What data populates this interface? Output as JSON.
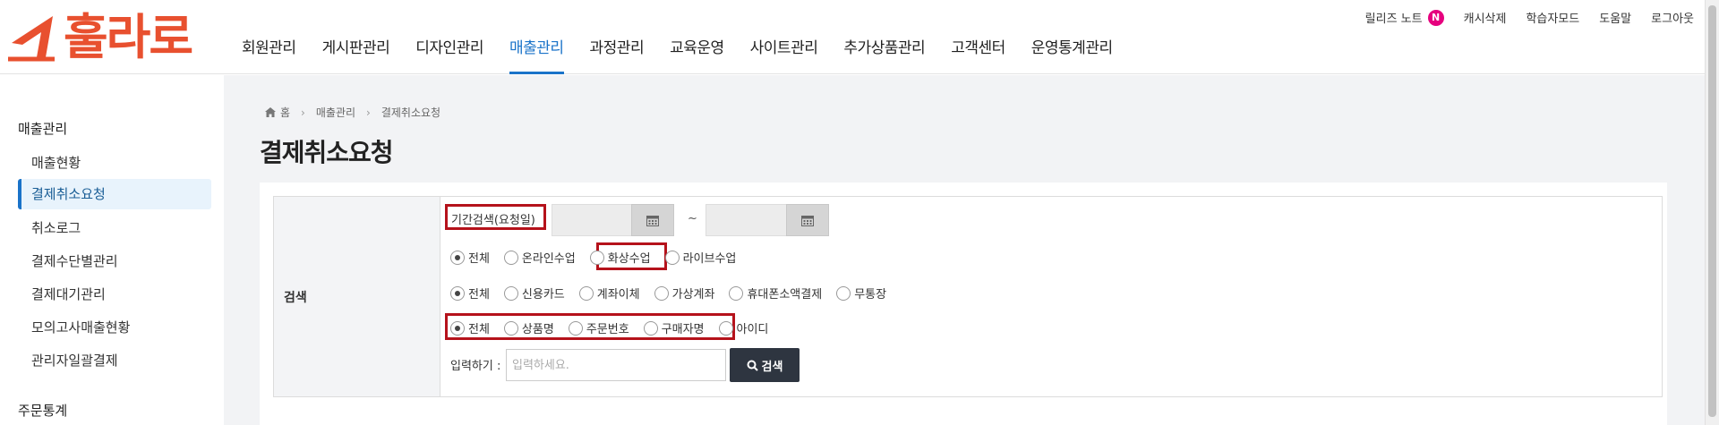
{
  "logo": {
    "text": "훌라로"
  },
  "gnb": [
    {
      "label": "회원관리",
      "active": false
    },
    {
      "label": "게시판관리",
      "active": false
    },
    {
      "label": "디자인관리",
      "active": false
    },
    {
      "label": "매출관리",
      "active": true
    },
    {
      "label": "과정관리",
      "active": false
    },
    {
      "label": "교육운영",
      "active": false
    },
    {
      "label": "사이트관리",
      "active": false
    },
    {
      "label": "추가상품관리",
      "active": false
    },
    {
      "label": "고객센터",
      "active": false
    },
    {
      "label": "운영통계관리",
      "active": false
    }
  ],
  "util": {
    "release_note": "릴리즈 노트",
    "release_badge": "N",
    "cache_delete": "캐시삭제",
    "learning_mode": "학습자모드",
    "help": "도움말",
    "logout": "로그아웃"
  },
  "sidebar": {
    "section1": "매출관리",
    "items": [
      {
        "label": "매출현황",
        "active": false
      },
      {
        "label": "결제취소요청",
        "active": true
      },
      {
        "label": "취소로그",
        "active": false
      },
      {
        "label": "결제수단별관리",
        "active": false
      },
      {
        "label": "결제대기관리",
        "active": false
      },
      {
        "label": "모의고사매출현황",
        "active": false
      },
      {
        "label": "관리자일괄결제",
        "active": false
      }
    ],
    "section2": "주문통계"
  },
  "breadcrumb": {
    "home": "홈",
    "level1": "매출관리",
    "level2": "결제취소요청"
  },
  "page_title": "결제취소요청",
  "search": {
    "header": "검색",
    "period_label": "기간검색(요청일)",
    "date_from": "",
    "date_to": "",
    "tilde": "~",
    "class_type": [
      {
        "label": "전체",
        "checked": true
      },
      {
        "label": "온라인수업",
        "checked": false
      },
      {
        "label": "화상수업",
        "checked": false
      },
      {
        "label": "라이브수업",
        "checked": false
      }
    ],
    "pay_method": [
      {
        "label": "전체",
        "checked": true
      },
      {
        "label": "신용카드",
        "checked": false
      },
      {
        "label": "계좌이체",
        "checked": false
      },
      {
        "label": "가상계좌",
        "checked": false
      },
      {
        "label": "휴대폰소액결제",
        "checked": false
      },
      {
        "label": "무통장",
        "checked": false
      }
    ],
    "keyword_type": [
      {
        "label": "전체",
        "checked": true
      },
      {
        "label": "상품명",
        "checked": false
      },
      {
        "label": "주문번호",
        "checked": false
      },
      {
        "label": "구매자명",
        "checked": false
      },
      {
        "label": "아이디",
        "checked": false
      }
    ],
    "input_label": "입력하기 :",
    "input_placeholder": "입력하세요.",
    "input_value": "",
    "button_label": "검색"
  },
  "colors": {
    "brand": "#e8502f",
    "accent": "#1a73c9",
    "highlight": "#b5121b",
    "button": "#2e3540"
  }
}
